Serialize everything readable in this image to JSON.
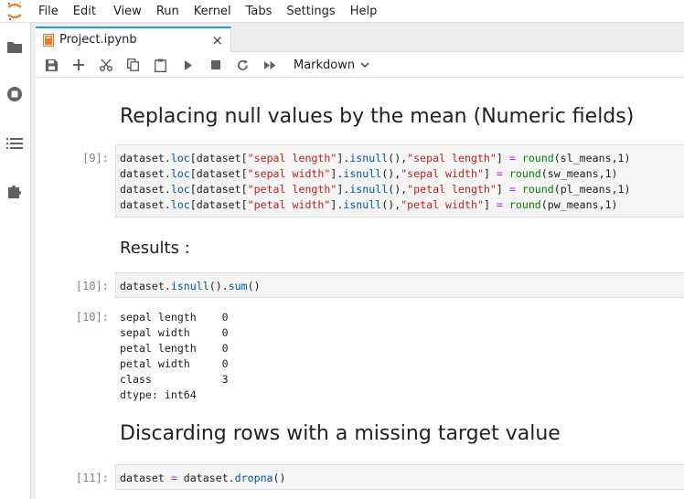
{
  "menu": [
    "File",
    "Edit",
    "View",
    "Run",
    "Kernel",
    "Tabs",
    "Settings",
    "Help"
  ],
  "sidebar_icons": [
    "folder-icon",
    "running-icon",
    "list-icon",
    "extension-icon"
  ],
  "tab": {
    "label": "Project.ipynb",
    "close": "×"
  },
  "toolbar": {
    "cell_type": "Markdown"
  },
  "cells": {
    "h1_replace": "Replacing null values by the mean (Numeric fields)",
    "prompt_9": "[9]:",
    "code_9": [
      {
        "a": "dataset.",
        "b": "loc",
        "c": "[dataset[",
        "d": "\"sepal length\"",
        "e": "].",
        "f": "isnull",
        "g": "(),",
        "h": "\"sepal length\"",
        "i": "] ",
        "j": "=",
        "k": " ",
        "l": "round",
        "m": "(sl_means,1)"
      },
      {
        "a": "dataset.",
        "b": "loc",
        "c": "[dataset[",
        "d": "\"sepal width\"",
        "e": "].",
        "f": "isnull",
        "g": "(),",
        "h": "\"sepal width\"",
        "i": "] ",
        "j": "=",
        "k": " ",
        "l": "round",
        "m": "(sw_means,1)"
      },
      {
        "a": "dataset.",
        "b": "loc",
        "c": "[dataset[",
        "d": "\"petal length\"",
        "e": "].",
        "f": "isnull",
        "g": "(),",
        "h": "\"petal length\"",
        "i": "] ",
        "j": "=",
        "k": " ",
        "l": "round",
        "m": "(pl_means,1)"
      },
      {
        "a": "dataset.",
        "b": "loc",
        "c": "[dataset[",
        "d": "\"petal width\"",
        "e": "].",
        "f": "isnull",
        "g": "(),",
        "h": "\"petal width\"",
        "i": "] ",
        "j": "=",
        "k": " ",
        "l": "round",
        "m": "(pw_means,1)"
      }
    ],
    "h2_results": "Results :",
    "prompt_10_in": "[10]:",
    "code_10": {
      "a": "dataset.",
      "b": "isnull",
      "c": "().",
      "d": "sum",
      "e": "()"
    },
    "prompt_10_out": "[10]:",
    "output_10": [
      "sepal length    0",
      "sepal width     0",
      "petal length    0",
      "petal width     0",
      "class           3",
      "dtype: int64"
    ],
    "h1_discard": "Discarding rows with a missing target value",
    "prompt_11": "[11]:",
    "code_11": {
      "a": "dataset ",
      "b": "=",
      "c": " dataset.",
      "d": "dropna",
      "e": "()"
    }
  },
  "colors": {
    "accent": "#2196f3",
    "logo": "#f37726",
    "string": "#ba2121",
    "function": "#0055aa",
    "operator": "#aa22ff",
    "builtin": "#008000"
  }
}
